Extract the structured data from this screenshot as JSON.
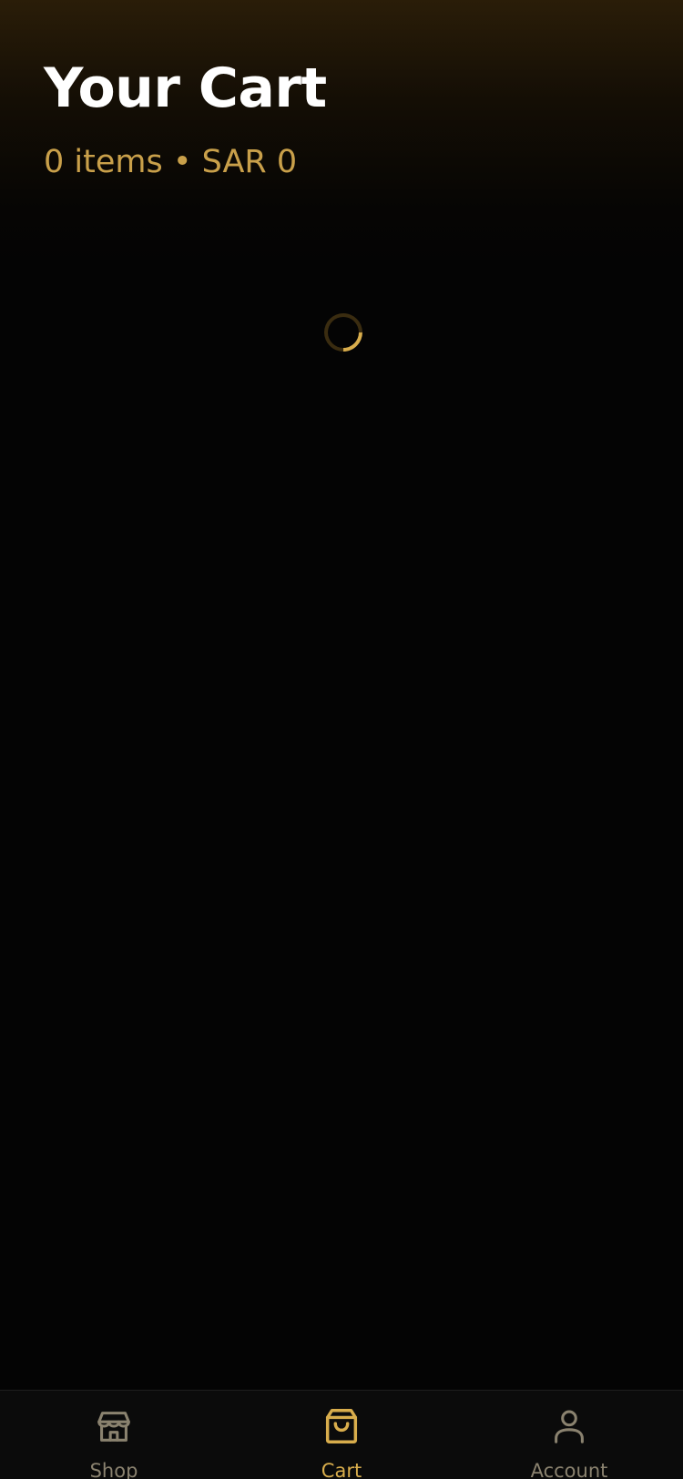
{
  "header": {
    "title": "Your Cart",
    "summary": "0 items • SAR 0"
  },
  "loading": {
    "icon": "loading-spinner"
  },
  "tabbar": {
    "active": "cart",
    "tabs": [
      {
        "id": "shop",
        "label": "Shop",
        "icon": "storefront-icon"
      },
      {
        "id": "cart",
        "label": "Cart",
        "icon": "shopping-bag-icon"
      },
      {
        "id": "account",
        "label": "Account",
        "icon": "person-icon"
      }
    ]
  },
  "colors": {
    "accent": "#d8ad4c",
    "summary_text": "#c9a04a",
    "inactive_tab": "#8a826f",
    "background": "#040404"
  }
}
